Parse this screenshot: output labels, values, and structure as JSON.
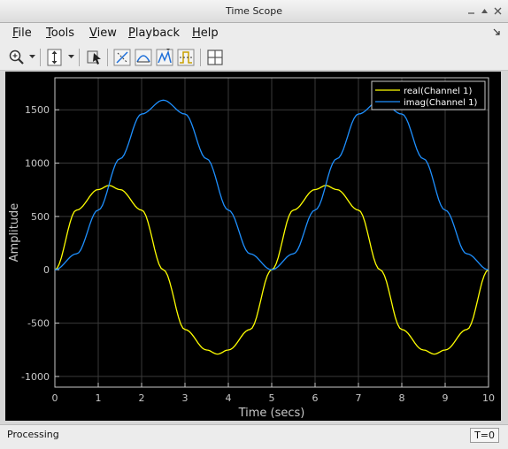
{
  "window": {
    "title": "Time Scope"
  },
  "menu": [
    {
      "first": "F",
      "rest": "ile"
    },
    {
      "first": "T",
      "rest": "ools"
    },
    {
      "first": "V",
      "rest": "iew"
    },
    {
      "first": "P",
      "rest": "layback"
    },
    {
      "first": "H",
      "rest": "elp"
    }
  ],
  "toolbar": {
    "buttons": [
      {
        "name": "zoom-in-icon"
      },
      {
        "name": "zoom-y-icon"
      },
      {
        "name": "data-cursor-icon"
      },
      {
        "name": "cursor-measurements-icon"
      },
      {
        "name": "signal-statistics-icon"
      },
      {
        "name": "peak-finder-icon"
      },
      {
        "name": "bilevel-measurements-icon"
      },
      {
        "name": "triggers-icon"
      },
      {
        "name": "layout-icon"
      }
    ]
  },
  "status": {
    "text": "Processing",
    "time": "T=0"
  },
  "colors": {
    "real": "#ffff00",
    "imag": "#1e90ff",
    "background": "#000000",
    "axes": "#c8c8c8",
    "grid": "#3a3a3a"
  },
  "chart_data": {
    "type": "line",
    "title": "",
    "xlabel": "Time (secs)",
    "ylabel": "Amplitude",
    "xlim": [
      0,
      10
    ],
    "ylim": [
      -1100,
      1800
    ],
    "xticks": [
      0,
      1,
      2,
      3,
      4,
      5,
      6,
      7,
      8,
      9,
      10
    ],
    "yticks": [
      -1000,
      -500,
      0,
      500,
      1000,
      1500
    ],
    "grid": true,
    "legend_position": "top-right",
    "series": [
      {
        "name": "real(Channel 1)",
        "x": [
          0,
          0.5,
          1,
          1.25,
          1.5,
          2,
          2.5,
          3,
          3.5,
          3.75,
          4,
          4.5,
          5,
          5.5,
          6,
          6.25,
          6.5,
          7,
          7.5,
          8,
          8.5,
          8.75,
          9,
          9.5,
          10
        ],
        "y": [
          0,
          560,
          752,
          790,
          752,
          560,
          0,
          -560,
          -752,
          -790,
          -752,
          -560,
          0,
          560,
          752,
          790,
          752,
          560,
          0,
          -560,
          -752,
          -790,
          -752,
          -560,
          0
        ]
      },
      {
        "name": "imag(Channel 1)",
        "x": [
          0,
          0.5,
          1,
          1.5,
          2,
          2.5,
          3,
          3.5,
          4,
          4.5,
          5,
          5.5,
          6,
          6.5,
          7,
          7.5,
          8,
          8.5,
          9,
          9.5,
          10
        ],
        "y": [
          0,
          150,
          560,
          1040,
          1460,
          1590,
          1460,
          1040,
          560,
          150,
          0,
          150,
          560,
          1040,
          1460,
          1590,
          1460,
          1040,
          560,
          150,
          0
        ]
      }
    ]
  }
}
